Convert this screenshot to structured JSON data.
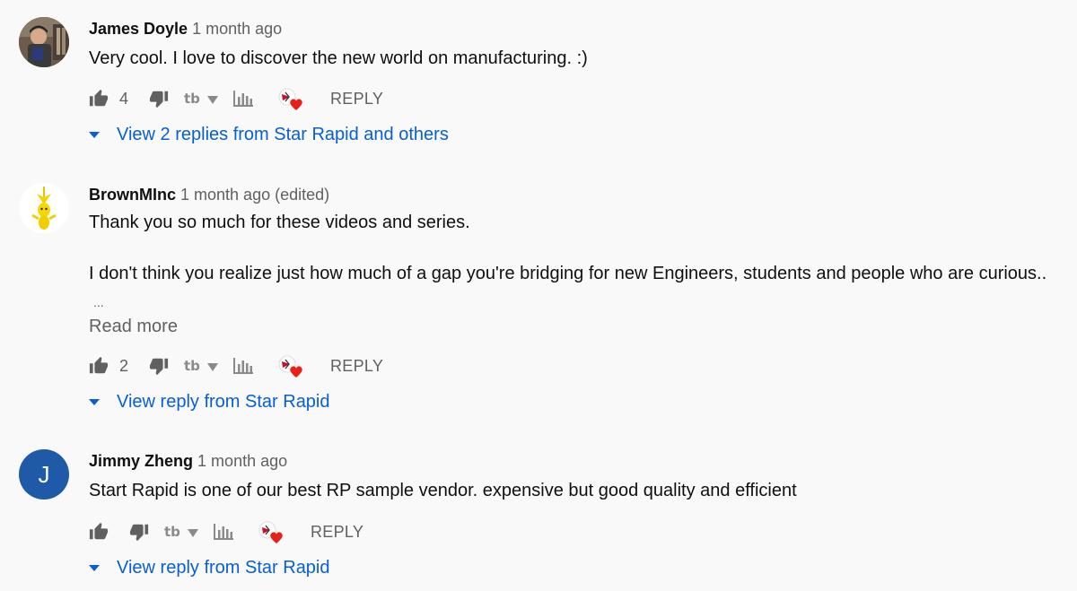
{
  "comments": [
    {
      "author": "James Doyle",
      "time": "1 month ago",
      "edited": "",
      "text_lines": [
        "Very cool. I love to discover the new world on manufacturing. :)"
      ],
      "likes": "4",
      "reply_label": "REPLY",
      "view_replies": "View 2 replies from Star Rapid and others",
      "avatar": "photo-avatar"
    },
    {
      "author": "BrownMInc",
      "time": "1 month ago",
      "edited": "(edited)",
      "text_lines": [
        "Thank you so much for these videos and series.",
        "I don't think you realize just how much of a gap you're bridging for new Engineers, students and people who are curious.."
      ],
      "ellipsis": "...",
      "read_more": "Read more",
      "likes": "2",
      "reply_label": "REPLY",
      "view_replies": "View reply from Star Rapid",
      "avatar": "yellow-character-avatar"
    },
    {
      "author": "Jimmy Zheng",
      "time": "1 month ago",
      "edited": "",
      "text_lines": [
        "Start Rapid is one of our best RP sample vendor. expensive but good quality and efficient"
      ],
      "likes": "",
      "reply_label": "REPLY",
      "view_replies": "View reply from Star Rapid",
      "avatar_letter": "J",
      "avatar_color": "#1e5aa8"
    }
  ],
  "colors": {
    "background": "#f9f9f9",
    "link": "#065fd4",
    "secondary_text": "#606060",
    "icon": "#606060",
    "heart": "#e62117"
  }
}
